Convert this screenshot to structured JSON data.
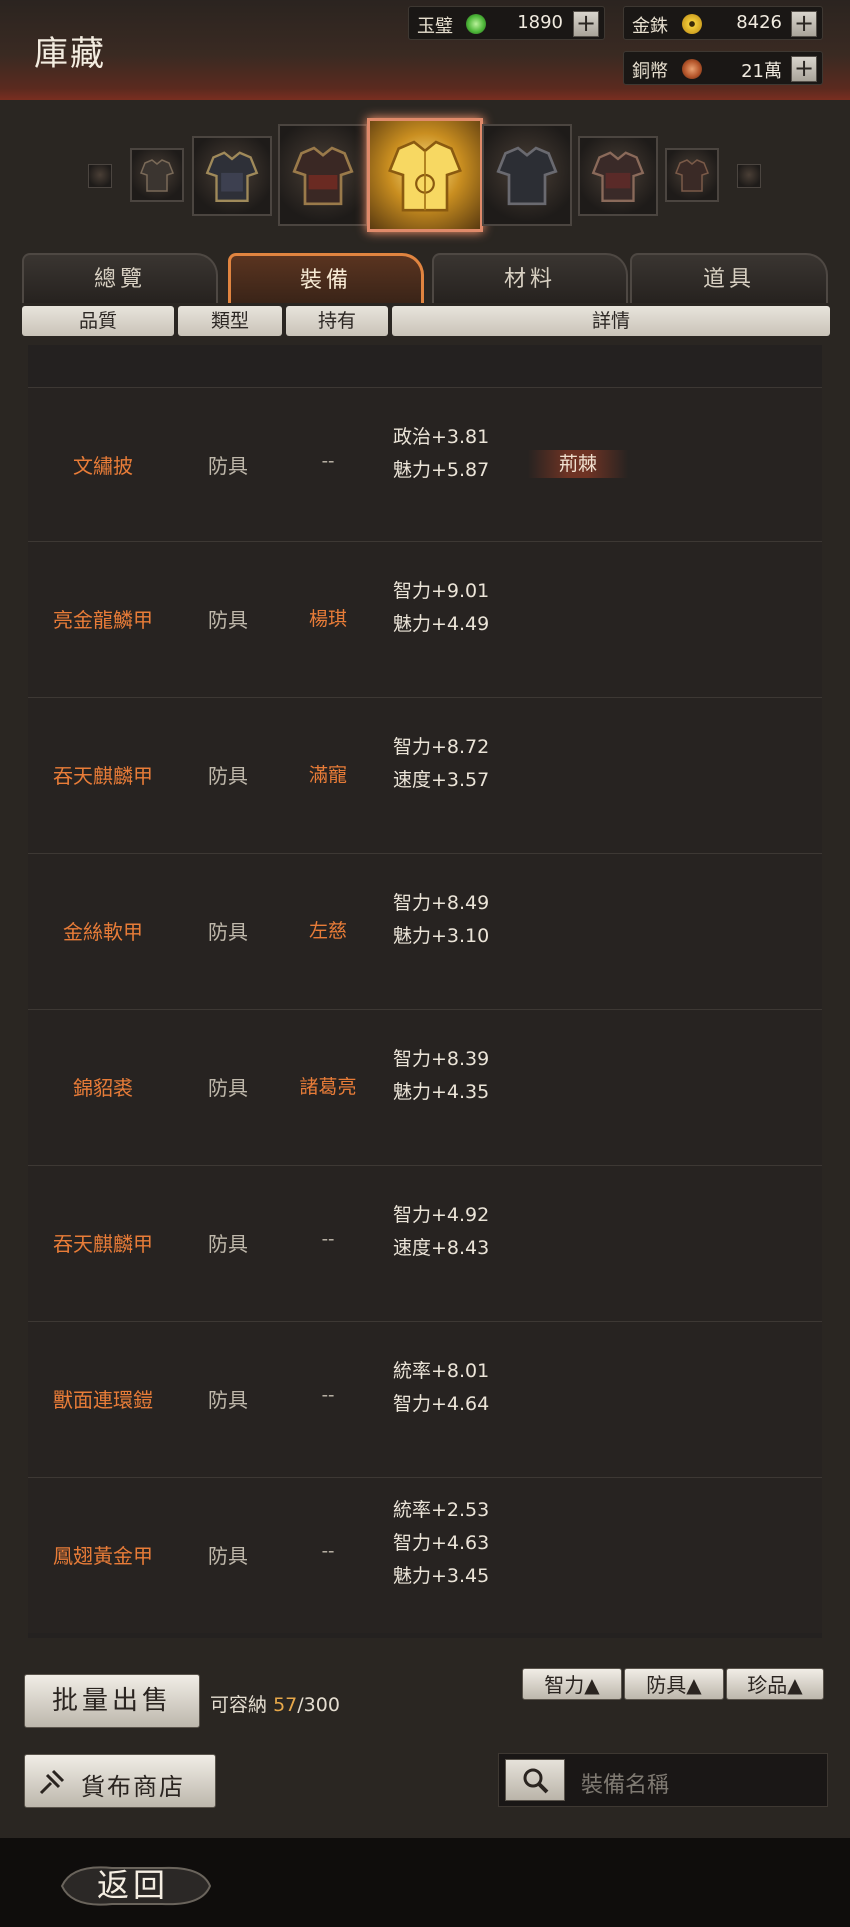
{
  "header": {
    "title": "庫藏",
    "currencies": [
      {
        "name": "玉璧",
        "value": "1890",
        "icon": "jade-coin-icon",
        "color": "#4fb83a"
      },
      {
        "name": "金銖",
        "value": "8426",
        "icon": "gold-coin-icon",
        "color": "#e6b020"
      },
      {
        "name": "銅幣",
        "value": "21萬",
        "icon": "copper-coin-icon",
        "color": "#c86a3a"
      }
    ]
  },
  "tabs": [
    {
      "label": "總覽",
      "active": false
    },
    {
      "label": "裝備",
      "active": true
    },
    {
      "label": "材料",
      "active": false
    },
    {
      "label": "道具",
      "active": false
    }
  ],
  "columns": [
    "品質",
    "類型",
    "持有",
    "詳情"
  ],
  "items": [
    {
      "name": "文繡披",
      "type": "防具",
      "owner": "--",
      "stats": [
        "政治+3.81",
        "魅力+5.87"
      ],
      "tag": "荊棘"
    },
    {
      "name": "亮金龍鱗甲",
      "type": "防具",
      "owner": "楊琪",
      "stats": [
        "智力+9.01",
        "魅力+4.49"
      ],
      "tag": ""
    },
    {
      "name": "吞天麒麟甲",
      "type": "防具",
      "owner": "滿寵",
      "stats": [
        "智力+8.72",
        "速度+3.57"
      ],
      "tag": ""
    },
    {
      "name": "金絲軟甲",
      "type": "防具",
      "owner": "左慈",
      "stats": [
        "智力+8.49",
        "魅力+3.10"
      ],
      "tag": ""
    },
    {
      "name": "錦貂裘",
      "type": "防具",
      "owner": "諸葛亮",
      "stats": [
        "智力+8.39",
        "魅力+4.35"
      ],
      "tag": ""
    },
    {
      "name": "吞天麒麟甲",
      "type": "防具",
      "owner": "--",
      "stats": [
        "智力+4.92",
        "速度+8.43"
      ],
      "tag": ""
    },
    {
      "name": "獸面連環鎧",
      "type": "防具",
      "owner": "--",
      "stats": [
        "統率+8.01",
        "智力+4.64"
      ],
      "tag": ""
    },
    {
      "name": "鳳翅黃金甲",
      "type": "防具",
      "owner": "--",
      "stats": [
        "統率+2.53",
        "智力+4.63",
        "魅力+3.45"
      ],
      "tag": ""
    }
  ],
  "bulk_sell_label": "批量出售",
  "capacity": {
    "label": "可容納",
    "used": "57",
    "total": "/300"
  },
  "sort_buttons": [
    "智力▲",
    "防具▲",
    "珍品▲"
  ],
  "currency_shop_label": "貨布商店",
  "search": {
    "placeholder": "裝備名稱"
  },
  "back_label": "返回"
}
